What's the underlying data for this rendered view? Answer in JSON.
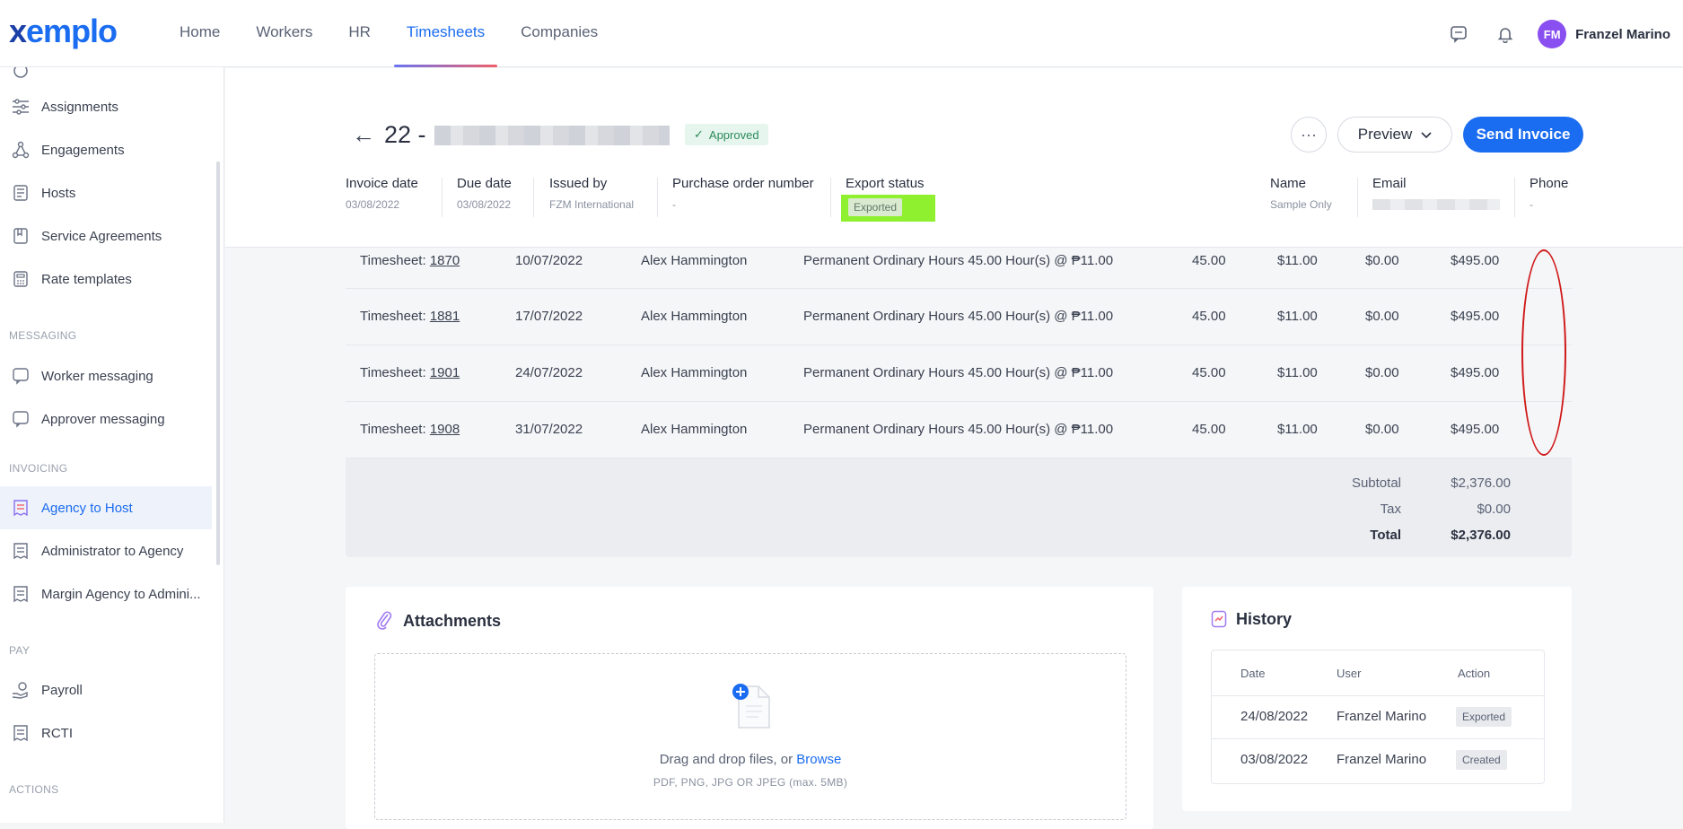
{
  "brand": {
    "logo": "xemplo",
    "accent": "#1a6cf0"
  },
  "nav": {
    "links": [
      "Home",
      "Workers",
      "HR",
      "Timesheets",
      "Companies"
    ],
    "active": "Timesheets",
    "user_initials": "FM",
    "user_name": "Franzel Marino"
  },
  "sidebar": {
    "items": [
      {
        "label": "Assignments",
        "icon": "sliders-icon"
      },
      {
        "label": "Engagements",
        "icon": "network-icon"
      },
      {
        "label": "Hosts",
        "icon": "building-icon"
      },
      {
        "label": "Service Agreements",
        "icon": "agreement-icon"
      },
      {
        "label": "Rate templates",
        "icon": "calculator-icon"
      }
    ],
    "messaging_heading": "MESSAGING",
    "messaging": [
      {
        "label": "Worker messaging",
        "icon": "chat-icon"
      },
      {
        "label": "Approver messaging",
        "icon": "chat-icon"
      }
    ],
    "invoicing_heading": "INVOICING",
    "invoicing": [
      {
        "label": "Agency to Host",
        "icon": "receipt-icon",
        "active": true
      },
      {
        "label": "Administrator to Agency",
        "icon": "receipt-icon"
      },
      {
        "label": "Margin Agency to Admini...",
        "icon": "receipt-icon"
      }
    ],
    "pay_heading": "PAY",
    "pay": [
      {
        "label": "Payroll",
        "icon": "payroll-icon"
      },
      {
        "label": "RCTI",
        "icon": "receipt-icon"
      }
    ],
    "actions_heading": "ACTIONS"
  },
  "invoice": {
    "number": "22 -",
    "status": "Approved",
    "buttons": {
      "more": "···",
      "preview": "Preview",
      "send": "Send Invoice"
    },
    "meta": {
      "invoice_date_label": "Invoice date",
      "invoice_date": "03/08/2022",
      "due_date_label": "Due date",
      "due_date": "03/08/2022",
      "issued_by_label": "Issued by",
      "issued_by": "FZM International",
      "po_label": "Purchase order number",
      "po": "-",
      "export_status_label": "Export status",
      "export_status": "Exported",
      "name_label": "Name",
      "name": "Sample Only",
      "email_label": "Email",
      "phone_label": "Phone",
      "phone": "-"
    }
  },
  "lines": [
    {
      "prefix": "Timesheet: ",
      "id": "1870",
      "date": "10/07/2022",
      "worker": "Alex Hammington",
      "desc": "Permanent Ordinary Hours 45.00 Hour(s) @ ₱11.00",
      "qty": "45.00",
      "rate": "$11.00",
      "tax": "$0.00",
      "amount": "$495.00"
    },
    {
      "prefix": "Timesheet: ",
      "id": "1881",
      "date": "17/07/2022",
      "worker": "Alex Hammington",
      "desc": "Permanent Ordinary Hours 45.00 Hour(s) @ ₱11.00",
      "qty": "45.00",
      "rate": "$11.00",
      "tax": "$0.00",
      "amount": "$495.00"
    },
    {
      "prefix": "Timesheet: ",
      "id": "1901",
      "date": "24/07/2022",
      "worker": "Alex Hammington",
      "desc": "Permanent Ordinary Hours 45.00 Hour(s) @ ₱11.00",
      "qty": "45.00",
      "rate": "$11.00",
      "tax": "$0.00",
      "amount": "$495.00"
    },
    {
      "prefix": "Timesheet: ",
      "id": "1908",
      "date": "31/07/2022",
      "worker": "Alex Hammington",
      "desc": "Permanent Ordinary Hours 45.00 Hour(s) @ ₱11.00",
      "qty": "45.00",
      "rate": "$11.00",
      "tax": "$0.00",
      "amount": "$495.00"
    }
  ],
  "totals": {
    "subtotal_label": "Subtotal",
    "subtotal": "$2,376.00",
    "tax_label": "Tax",
    "tax": "$0.00",
    "total_label": "Total",
    "total": "$2,376.00"
  },
  "attachments": {
    "title": "Attachments",
    "drop_text": "Drag and drop files, or ",
    "browse": "Browse",
    "hint": "PDF, PNG, JPG OR JPEG (max. 5MB)"
  },
  "history": {
    "title": "History",
    "headers": [
      "Date",
      "User",
      "Action"
    ],
    "rows": [
      {
        "date": "24/08/2022",
        "user": "Franzel Marino",
        "action": "Exported"
      },
      {
        "date": "03/08/2022",
        "user": "Franzel Marino",
        "action": "Created"
      }
    ]
  }
}
